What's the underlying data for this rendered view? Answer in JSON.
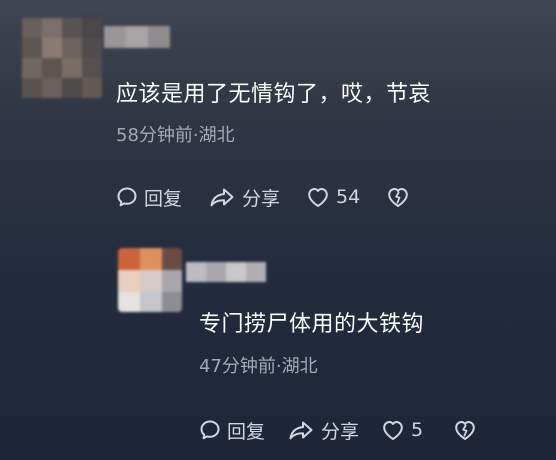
{
  "comments": [
    {
      "text": "应该是用了无情钩了，哎，节哀",
      "meta": "58分钟前·湖北",
      "actions": {
        "reply_label": "回复",
        "share_label": "分享",
        "like_count": "54"
      },
      "avatar_colors": [
        "#6a5f5b",
        "#7c6e68",
        "#595252",
        "#4a4748",
        "#5d5651",
        "#8a7b73",
        "#6d625d",
        "#504c4d",
        "#726660",
        "#5e5550",
        "#7a6d66",
        "#54504f",
        "#5a5350",
        "#6b605b",
        "#4e4a4a",
        "#635a56"
      ],
      "name_colors": [
        "#9a9597",
        "#a8a3a5",
        "#8f8b8e"
      ]
    },
    {
      "text": "专门捞尸体用的大铁钩",
      "meta": "47分钟前·湖北",
      "actions": {
        "reply_label": "回复",
        "share_label": "分享",
        "like_count": "5"
      },
      "avatar_colors": [
        "#c9643c",
        "#e0905f",
        "#6b4c45",
        "#e8d0c0",
        "#d7cbc6",
        "#a9a7ac",
        "#e6e2e1",
        "#c4c6cc",
        "#8d8e94"
      ],
      "name_colors": [
        "#bcbcc2",
        "#a9a8ae",
        "#c8c7cb",
        "#b1b0b5"
      ]
    }
  ],
  "colors": {
    "text_primary": "#ffffff",
    "text_meta": "#a3aab6",
    "icon": "#d2d6de"
  },
  "icons": [
    "comment-bubble-icon",
    "share-arrow-icon",
    "heart-outline-icon",
    "broken-heart-icon"
  ]
}
